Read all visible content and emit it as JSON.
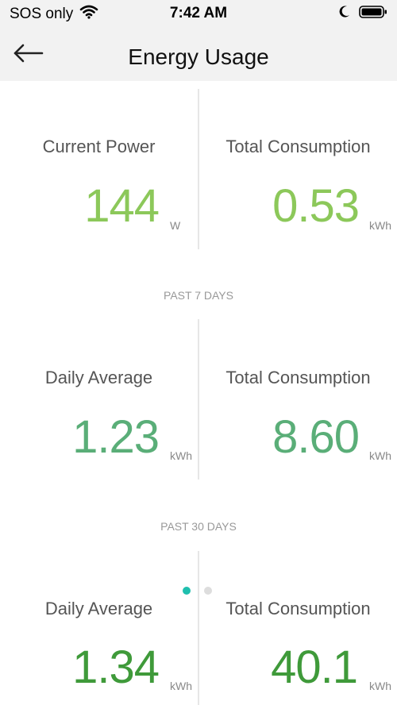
{
  "status_bar": {
    "carrier": "SOS only",
    "time": "7:42 AM"
  },
  "nav": {
    "title": "Energy Usage"
  },
  "now": {
    "current_power": {
      "label": "Current Power",
      "value": "144",
      "unit": "W"
    },
    "total_consumption": {
      "label": "Total Consumption",
      "value": "0.53",
      "unit": "kWh"
    }
  },
  "past_7_days": {
    "header": "PAST 7 DAYS",
    "daily_average": {
      "label": "Daily Average",
      "value": "1.23",
      "unit": "kWh"
    },
    "total_consumption": {
      "label": "Total Consumption",
      "value": "8.60",
      "unit": "kWh"
    }
  },
  "past_30_days": {
    "header": "PAST 30 DAYS",
    "daily_average": {
      "label": "Daily Average",
      "value": "1.34",
      "unit": "kWh"
    },
    "total_consumption": {
      "label": "Total Consumption",
      "value": "40.1",
      "unit": "kWh"
    }
  },
  "pager": {
    "active_index": 0,
    "count": 2
  },
  "colors": {
    "green_light": "#8cc85a",
    "green_mid": "#5aae78",
    "green_dark": "#3f9a3a",
    "dot_active": "#1fbfae",
    "dot_inactive": "#dddddd"
  }
}
